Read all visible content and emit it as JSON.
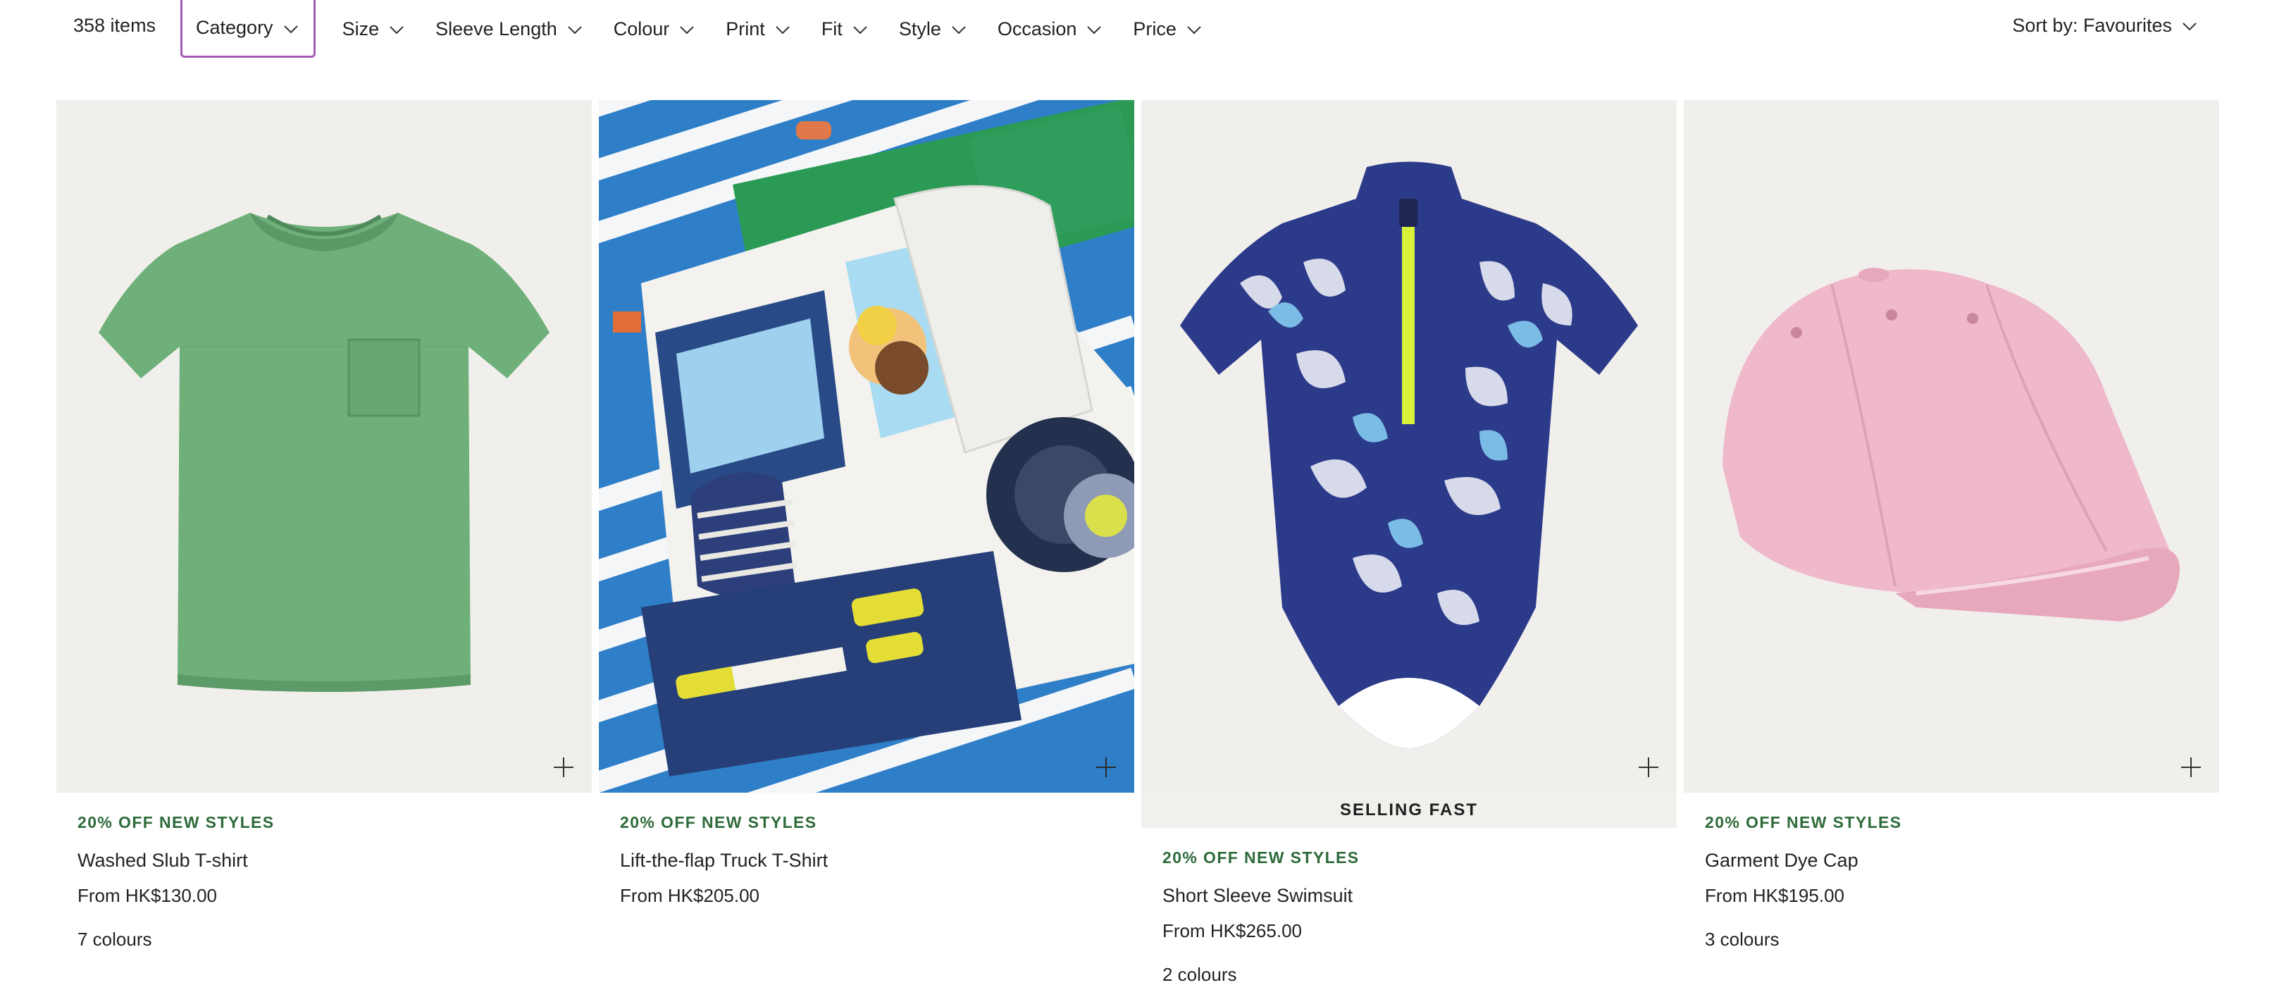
{
  "toolbar": {
    "item_count": "358 items",
    "filters": [
      "Category",
      "Size",
      "Sleeve Length",
      "Colour",
      "Print",
      "Fit",
      "Style",
      "Occasion",
      "Price"
    ],
    "active_filter": "Category",
    "sort_label": "Sort by: Favourites",
    "active_outline_color": "#a25bb8"
  },
  "products": [
    {
      "promo": "20% OFF NEW STYLES",
      "name": "Washed Slub T-shirt",
      "price": "From HK$130.00",
      "colours": "7 colours",
      "image": "green-tshirt-image",
      "image_bg": "#f1efec"
    },
    {
      "promo": "20% OFF NEW STYLES",
      "name": "Lift-the-flap Truck T-Shirt",
      "price": "From HK$205.00",
      "colours": "",
      "image": "truck-applique-closeup-image",
      "image_bg": "#2f7fc8"
    },
    {
      "flag": "SELLING FAST",
      "promo": "20% OFF NEW STYLES",
      "name": "Short Sleeve Swimsuit",
      "price": "From HK$265.00",
      "colours": "2 colours",
      "image": "blue-print-swimsuit-image",
      "image_bg": "#f1efec"
    },
    {
      "promo": "20% OFF NEW STYLES",
      "name": "Garment Dye Cap",
      "price": "From HK$195.00",
      "colours": "3 colours",
      "image": "pink-cap-image",
      "image_bg": "#f1efec"
    }
  ],
  "colors": {
    "promo_green": "#2e6b3a",
    "text": "#222222",
    "flag_bg": "#f2f0ed"
  }
}
